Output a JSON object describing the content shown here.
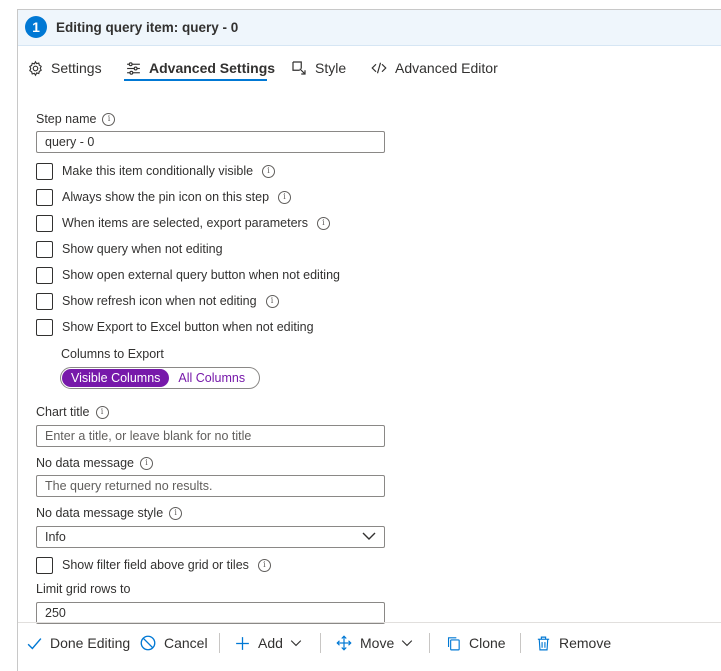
{
  "header": {
    "step_number": "1",
    "title": "Editing query item: query - 0"
  },
  "tabs": [
    {
      "label": "Settings",
      "icon": "gear-icon"
    },
    {
      "label": "Advanced Settings",
      "icon": "sliders-icon",
      "active": true
    },
    {
      "label": "Style",
      "icon": "style-icon"
    },
    {
      "label": "Advanced Editor",
      "icon": "code-icon"
    }
  ],
  "form": {
    "step_name": {
      "label": "Step name",
      "value": "query - 0"
    },
    "checks": [
      {
        "label": "Make this item conditionally visible",
        "checked": false
      },
      {
        "label": "Always show the pin icon on this step",
        "checked": false
      },
      {
        "label": "When items are selected, export parameters",
        "checked": false
      },
      {
        "label": "Show query when not editing",
        "checked": false
      },
      {
        "label": "Show open external query button when not editing",
        "checked": false
      },
      {
        "label": "Show refresh icon when not editing",
        "checked": false
      },
      {
        "label": "Show Export to Excel button when not editing",
        "checked": false
      }
    ],
    "export": {
      "label": "Columns to Export",
      "options": [
        "Visible Columns",
        "All Columns"
      ],
      "selected": "Visible Columns"
    },
    "chart_title": {
      "label": "Chart title",
      "placeholder": "Enter a title, or leave blank for no title"
    },
    "no_data_message": {
      "label": "No data message",
      "placeholder": "The query returned no results."
    },
    "no_data_style": {
      "label": "No data message style",
      "value": "Info"
    },
    "filter_check": {
      "label": "Show filter field above grid or tiles",
      "checked": false
    },
    "limit_rows": {
      "label": "Limit grid rows to",
      "value": "250"
    }
  },
  "footer": {
    "done": "Done Editing",
    "cancel": "Cancel",
    "add": "Add",
    "move": "Move",
    "clone": "Clone",
    "remove": "Remove"
  },
  "colors": {
    "accent": "#0078d4",
    "toggle": "#7719aa"
  }
}
